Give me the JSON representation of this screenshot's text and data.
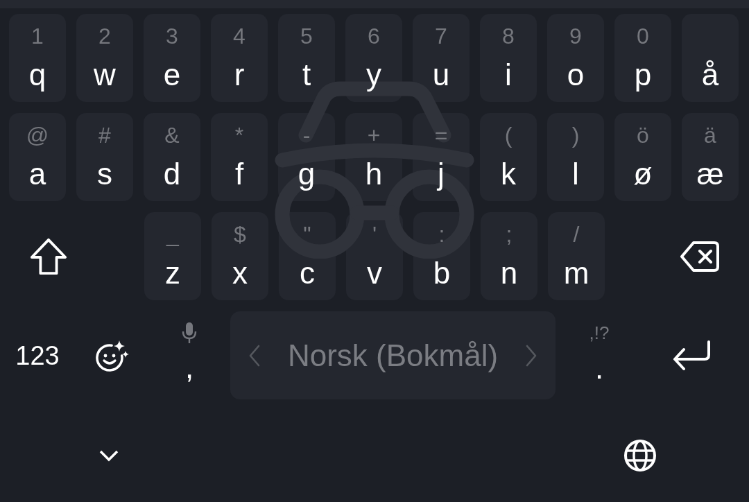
{
  "keyboard": {
    "incognito": true,
    "rows": [
      {
        "keys": [
          {
            "kind": "letter",
            "label": "q",
            "hint": "1"
          },
          {
            "kind": "letter",
            "label": "w",
            "hint": "2"
          },
          {
            "kind": "letter",
            "label": "e",
            "hint": "3"
          },
          {
            "kind": "letter",
            "label": "r",
            "hint": "4"
          },
          {
            "kind": "letter",
            "label": "t",
            "hint": "5"
          },
          {
            "kind": "letter",
            "label": "y",
            "hint": "6"
          },
          {
            "kind": "letter",
            "label": "u",
            "hint": "7"
          },
          {
            "kind": "letter",
            "label": "i",
            "hint": "8"
          },
          {
            "kind": "letter",
            "label": "o",
            "hint": "9"
          },
          {
            "kind": "letter",
            "label": "p",
            "hint": "0"
          },
          {
            "kind": "letter",
            "label": "å"
          }
        ]
      },
      {
        "keys": [
          {
            "kind": "letter",
            "label": "a",
            "hint": "@"
          },
          {
            "kind": "letter",
            "label": "s",
            "hint": "#"
          },
          {
            "kind": "letter",
            "label": "d",
            "hint": "&"
          },
          {
            "kind": "letter",
            "label": "f",
            "hint": "*"
          },
          {
            "kind": "letter",
            "label": "g",
            "hint": "-"
          },
          {
            "kind": "letter",
            "label": "h",
            "hint": "+"
          },
          {
            "kind": "letter",
            "label": "j",
            "hint": "="
          },
          {
            "kind": "letter",
            "label": "k",
            "hint": "("
          },
          {
            "kind": "letter",
            "label": "l",
            "hint": ")"
          },
          {
            "kind": "letter",
            "label": "ø",
            "hint": "ö"
          },
          {
            "kind": "letter",
            "label": "æ",
            "hint": "ä"
          }
        ]
      },
      {
        "keys": [
          {
            "kind": "shift",
            "on": false
          },
          {
            "kind": "letter",
            "label": "z",
            "hint": "_"
          },
          {
            "kind": "letter",
            "label": "x",
            "hint": "$"
          },
          {
            "kind": "letter",
            "label": "c",
            "hint": "\""
          },
          {
            "kind": "letter",
            "label": "v",
            "hint": "'"
          },
          {
            "kind": "letter",
            "label": "b",
            "hint": ":"
          },
          {
            "kind": "letter",
            "label": "n",
            "hint": ";"
          },
          {
            "kind": "letter",
            "label": "m",
            "hint": "/"
          },
          {
            "kind": "backspace"
          }
        ]
      },
      {
        "keys": [
          {
            "kind": "symbols",
            "label": "123"
          },
          {
            "kind": "emoji"
          },
          {
            "kind": "comma",
            "label": ","
          },
          {
            "kind": "space",
            "label": "Norsk (Bokmål)"
          },
          {
            "kind": "period",
            "label": ".",
            "hint": ",!?"
          },
          {
            "kind": "enter"
          }
        ]
      }
    ]
  },
  "bottom_bar": [
    {
      "kind": "hide"
    },
    {
      "kind": "language"
    }
  ]
}
